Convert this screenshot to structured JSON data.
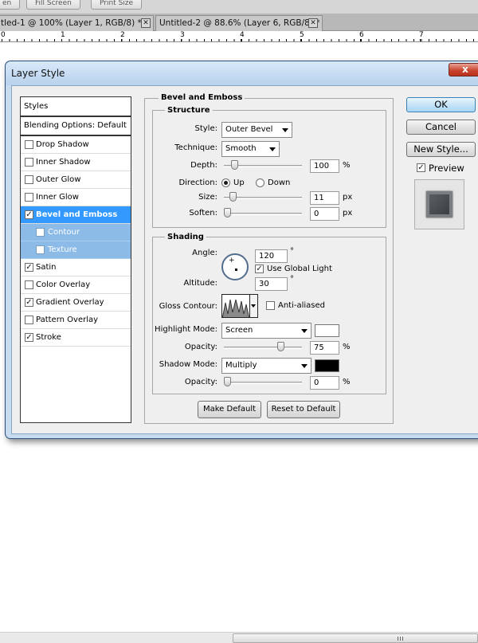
{
  "toolbar": {
    "btn_first": "en",
    "fill_screen": "Fill Screen",
    "print_size": "Print Size"
  },
  "tabs": [
    {
      "label": "tled-1 @ 100% (Layer 1, RGB/8) *"
    },
    {
      "label": "Untitled-2 @ 88.6% (Layer 6, RGB/8) *"
    }
  ],
  "ruler": {
    "numbers": [
      "0",
      "1",
      "2",
      "3",
      "4",
      "5",
      "6",
      "7"
    ]
  },
  "dialog": {
    "title": "Layer Style",
    "close": "x"
  },
  "styles_list": {
    "header": "Styles",
    "blending": "Blending Options: Default",
    "items": [
      {
        "label": "Drop Shadow",
        "checked": false
      },
      {
        "label": "Inner Shadow",
        "checked": false
      },
      {
        "label": "Outer Glow",
        "checked": false
      },
      {
        "label": "Inner Glow",
        "checked": false
      },
      {
        "label": "Bevel and Emboss",
        "checked": true,
        "selected": true
      },
      {
        "label": "Contour",
        "checked": false,
        "sub": true
      },
      {
        "label": "Texture",
        "checked": false,
        "sub": true
      },
      {
        "label": "Satin",
        "checked": true
      },
      {
        "label": "Color Overlay",
        "checked": false
      },
      {
        "label": "Gradient Overlay",
        "checked": true
      },
      {
        "label": "Pattern Overlay",
        "checked": false
      },
      {
        "label": "Stroke",
        "checked": true
      }
    ]
  },
  "bevel": {
    "section_title": "Bevel and Emboss",
    "structure": {
      "title": "Structure",
      "style_label": "Style:",
      "style_value": "Outer Bevel",
      "technique_label": "Technique:",
      "technique_value": "Smooth",
      "depth_label": "Depth:",
      "depth_value": "100",
      "depth_unit": "%",
      "depth_slider_fraction": 0.1,
      "direction_label": "Direction:",
      "direction_up": "Up",
      "direction_down": "Down",
      "direction_selected": "Up",
      "size_label": "Size:",
      "size_value": "11",
      "size_unit": "px",
      "size_slider_fraction": 0.08,
      "soften_label": "Soften:",
      "soften_value": "0",
      "soften_unit": "px",
      "soften_slider_fraction": 0.0
    },
    "shading": {
      "title": "Shading",
      "angle_label": "Angle:",
      "angle_value": "120",
      "angle_unit": "°",
      "global_light_label": "Use Global Light",
      "global_light_checked": true,
      "altitude_label": "Altitude:",
      "altitude_value": "30",
      "altitude_unit": "°",
      "gloss_label": "Gloss Contour:",
      "anti_aliased_label": "Anti-aliased",
      "anti_aliased_checked": false,
      "highlight_mode_label": "Highlight Mode:",
      "highlight_mode_value": "Screen",
      "highlight_color": "#ffffff",
      "highlight_opacity_label": "Opacity:",
      "highlight_opacity_value": "75",
      "highlight_opacity_unit": "%",
      "highlight_opacity_fraction": 0.75,
      "shadow_mode_label": "Shadow Mode:",
      "shadow_mode_value": "Multiply",
      "shadow_color": "#000000",
      "shadow_opacity_label": "Opacity:",
      "shadow_opacity_value": "0",
      "shadow_opacity_unit": "%",
      "shadow_opacity_fraction": 0.0
    },
    "make_default": "Make Default",
    "reset_default": "Reset to Default"
  },
  "actions": {
    "ok": "OK",
    "cancel": "Cancel",
    "new_style": "New Style...",
    "preview_label": "Preview",
    "preview_checked": true
  },
  "colors": {
    "selected_row": "#3399ff",
    "sub_row": "#8cbbe8",
    "ok_button": "#a9d7f6"
  }
}
